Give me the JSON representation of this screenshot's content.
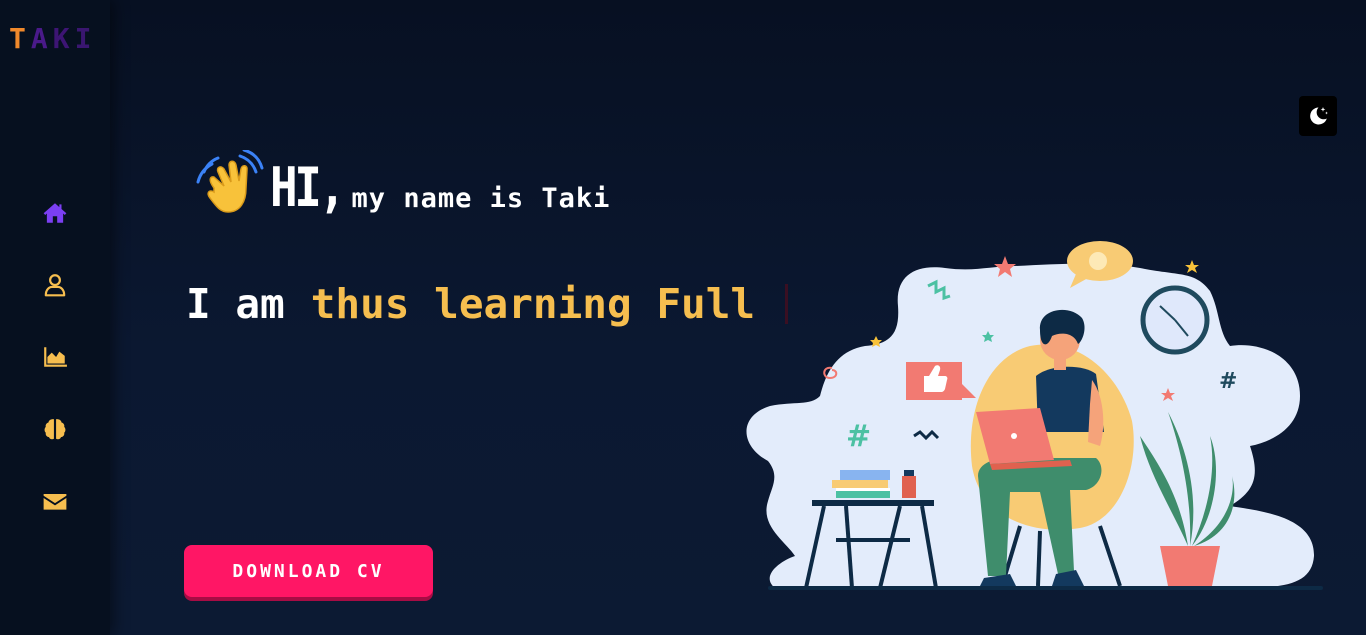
{
  "logo": {
    "letters": [
      "T",
      "A",
      "K",
      "I"
    ]
  },
  "sidebar": {
    "items": [
      {
        "name": "home",
        "icon": "home-icon",
        "color": "#7b3ff2"
      },
      {
        "name": "about",
        "icon": "user-icon",
        "color": "#f6be4f"
      },
      {
        "name": "skills",
        "icon": "chart-icon",
        "color": "#f6be4f"
      },
      {
        "name": "projects",
        "icon": "brain-icon",
        "color": "#f6be4f"
      },
      {
        "name": "contact",
        "icon": "envelope-icon",
        "color": "#f6be4f"
      }
    ]
  },
  "theme_toggle": {
    "icon": "moon-stars-icon"
  },
  "hero": {
    "wave_icon": "waving-hand-icon",
    "hi": "HI,",
    "intro": "my name is Taki",
    "typing_static": "I am",
    "typing_dynamic": "thus learning Full",
    "download_label": "DOWNLOAD CV"
  },
  "illustration": {
    "icon": "person-with-laptop-illustration"
  },
  "colors": {
    "accent_pink": "#ff1665",
    "accent_yellow": "#f6be4f",
    "accent_purple": "#7b3ff2",
    "logo_orange": "#f0892b",
    "background": "#0b1528"
  }
}
